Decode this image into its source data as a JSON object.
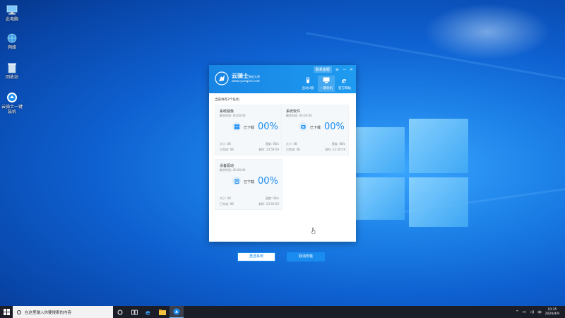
{
  "desktop": {
    "icons": [
      {
        "label": "此电脑",
        "icon": "computer-icon"
      },
      {
        "label": "网络",
        "icon": "network-icon"
      },
      {
        "label": "回收站",
        "icon": "recycle-bin-icon"
      },
      {
        "label": "云骑士一键装机",
        "icon": "yunqishi-icon"
      }
    ]
  },
  "app": {
    "brand_name": "云骑士",
    "brand_sub": "装机大师",
    "brand_url": "www.yunqishi.net",
    "feedback_label": "联系客服",
    "tabs": [
      {
        "label": "启动U盘",
        "icon": "usb-icon"
      },
      {
        "label": "一键装机",
        "icon": "monitor-icon",
        "active": true
      },
      {
        "label": "官方网站",
        "icon": "ie-icon"
      }
    ],
    "task_count_text": "当前共有3个任务:",
    "tasks": [
      {
        "name": "系统镜像",
        "remain": "剩余时间: 00:00:00",
        "status": "已下载",
        "percent": "00%",
        "size": "大小: 0B",
        "speed": "速度: 0B/s",
        "done": "已完成: 0B",
        "elapsed": "耗时: 23:59:59",
        "icon": "windows-icon"
      },
      {
        "name": "系统软件",
        "remain": "剩余时间: 00:00:00",
        "status": "已下载",
        "percent": "00%",
        "size": "大小: 0B",
        "speed": "速度: 0B/s",
        "done": "已完成: 0B",
        "elapsed": "耗时: 23:59:59",
        "icon": "software-icon"
      },
      {
        "name": "设备驱动",
        "remain": "剩余时间: 00:00:00",
        "status": "已下载",
        "percent": "00%",
        "size": "大小: 0B",
        "speed": "速度: 0B/s",
        "done": "已完成: 0B",
        "elapsed": "耗时: 23:59:59",
        "icon": "driver-icon"
      }
    ],
    "reselect_label": "重选系统",
    "cancel_label": "取消安装"
  },
  "taskbar": {
    "search_placeholder": "在这里输入你要搜索的内容",
    "ime": "中",
    "time": "10:35",
    "date": "2020/4/9"
  }
}
